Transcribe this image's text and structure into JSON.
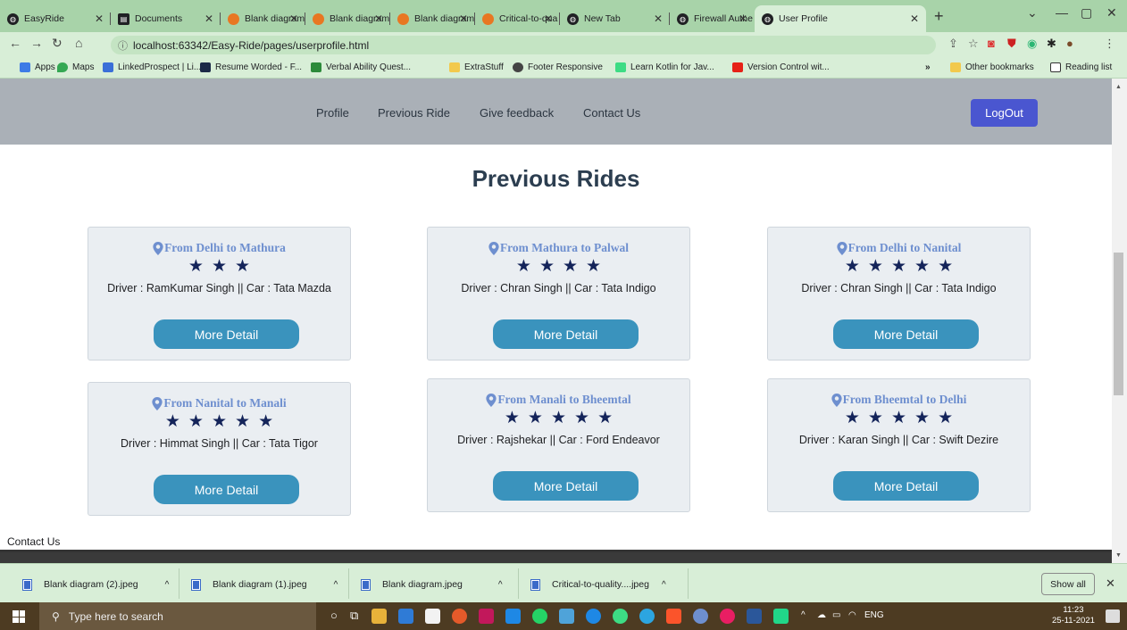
{
  "browser": {
    "tabs": [
      {
        "title": "EasyRide",
        "icon": "globe-icon",
        "color": "#202124"
      },
      {
        "title": "Documents",
        "icon": "document-icon",
        "color": "#202124"
      },
      {
        "title": "Blank diagram",
        "icon": "lucidchart-icon",
        "color": "#e87722"
      },
      {
        "title": "Blank diagram",
        "icon": "lucidchart-icon",
        "color": "#e87722"
      },
      {
        "title": "Blank diagram",
        "icon": "lucidchart-icon",
        "color": "#e87722"
      },
      {
        "title": "Critical-to-qua",
        "icon": "lucidchart-icon",
        "color": "#e87722"
      },
      {
        "title": "New Tab",
        "icon": "globe-icon",
        "color": "#202124"
      },
      {
        "title": "Firewall Authe",
        "icon": "globe-icon",
        "color": "#202124"
      },
      {
        "title": "User Profile",
        "icon": "globe-icon",
        "color": "#202124"
      }
    ],
    "url": "localhost:63342/Easy-Ride/pages/userprofile.html",
    "bookmarks": [
      {
        "label": "Apps",
        "color": "#3d7be6"
      },
      {
        "label": "Maps",
        "color": "#34a853"
      },
      {
        "label": "LinkedProspect | Li...",
        "color": "#3a6fd8"
      },
      {
        "label": "Resume Worded - F...",
        "color": "#1c2a48"
      },
      {
        "label": "Verbal Ability Quest...",
        "color": "#2c8a3a"
      },
      {
        "label": "ExtraStuff",
        "color": "#f2c94c"
      },
      {
        "label": "Footer Responsive",
        "color": "#444444"
      },
      {
        "label": "Learn Kotlin for Jav...",
        "color": "#3ddc84"
      },
      {
        "label": "Version Control wit...",
        "color": "#e62117"
      }
    ],
    "bookmarks_more": "»",
    "other_bookmarks": "Other bookmarks",
    "reading_list": "Reading list"
  },
  "page": {
    "nav": {
      "links": [
        "Profile",
        "Previous Ride",
        "Give feedback",
        "Contact Us"
      ],
      "logout": "LogOut"
    },
    "heading": "Previous Rides",
    "rides": [
      {
        "route": "From Delhi to Mathura",
        "rating": 3,
        "details": "Driver : RamKumar Singh || Car : Tata Mazda",
        "button": "More Detail"
      },
      {
        "route": "From Mathura to Palwal",
        "rating": 4,
        "details": "Driver : Chran Singh || Car : Tata Indigo",
        "button": "More Detail"
      },
      {
        "route": "From Delhi to Nanital",
        "rating": 5,
        "details": "Driver : Chran Singh || Car : Tata Indigo",
        "button": "More Detail"
      },
      {
        "route": "From Nanital to Manali",
        "rating": 5,
        "details": "Driver : Himmat Singh || Car : Tata Tigor",
        "button": "More Detail"
      },
      {
        "route": "From Manali to Bheemtal",
        "rating": 5,
        "details": "Driver : Rajshekar || Car : Ford Endeavor",
        "button": "More Detail"
      },
      {
        "route": "From Bheemtal to Delhi",
        "rating": 5,
        "details": "Driver : Karan Singh || Car : Swift Dezire",
        "button": "More Detail"
      }
    ],
    "footer_link": "Contact Us",
    "accent_color": "#3a93bd",
    "logout_color": "#4a56d0"
  },
  "downloads": {
    "items": [
      "Blank diagram (2).jpeg",
      "Blank diagram (1).jpeg",
      "Blank diagram.jpeg",
      "Critical-to-quality....jpeg"
    ],
    "show_all": "Show all"
  },
  "taskbar": {
    "search_placeholder": "Type here to search",
    "language": "ENG",
    "time": "11:23",
    "date": "25-11-2021"
  }
}
